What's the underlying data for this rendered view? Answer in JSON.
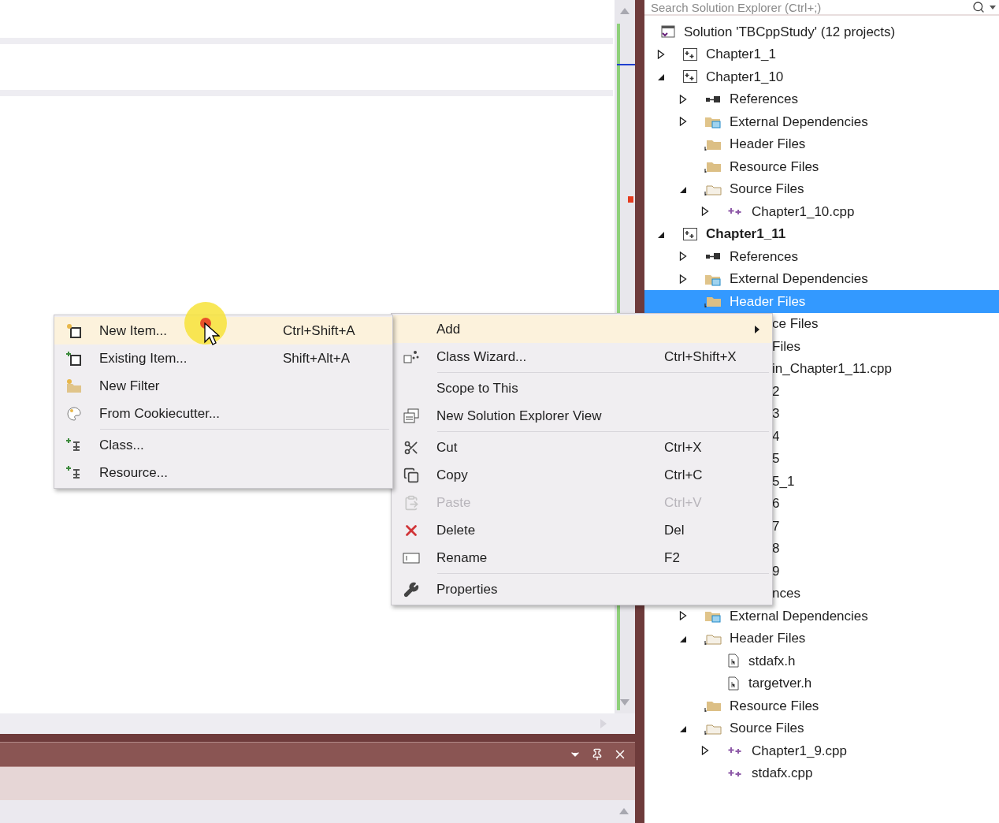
{
  "solution_explorer": {
    "search": {
      "placeholder": "Search Solution Explorer (Ctrl+;)"
    },
    "tree": [
      {
        "kind": "solution",
        "label": "Solution 'TBCppStudy' (12 projects)",
        "selected": false,
        "children": [
          {
            "kind": "project",
            "label": "Chapter1_1",
            "selected": false,
            "expanded": false,
            "startup": false
          },
          {
            "kind": "project",
            "label": "Chapter1_10",
            "selected": false,
            "expanded": true,
            "startup": false,
            "children": [
              {
                "kind": "references",
                "label": "References",
                "selected": false,
                "expanded": false
              },
              {
                "kind": "external",
                "label": "External Dependencies",
                "selected": false,
                "expanded": false
              },
              {
                "kind": "folder",
                "label": "Header Files",
                "selected": false
              },
              {
                "kind": "folder",
                "label": "Resource Files",
                "selected": false
              },
              {
                "kind": "folder-open",
                "label": "Source Files",
                "selected": false,
                "expanded": true,
                "children": [
                  {
                    "kind": "cpp",
                    "label": "Chapter1_10.cpp",
                    "selected": false,
                    "expanded": false
                  }
                ]
              }
            ]
          },
          {
            "kind": "project",
            "label": "Chapter1_11",
            "selected": false,
            "expanded": true,
            "startup": true,
            "children": [
              {
                "kind": "references",
                "label": "References",
                "selected": false,
                "expanded": false
              },
              {
                "kind": "external",
                "label": "External Dependencies",
                "selected": false,
                "expanded": false
              },
              {
                "kind": "folder",
                "label": "Header Files",
                "selected": true
              },
              {
                "kind": "cut",
                "label": "ce Files",
                "selected": false
              },
              {
                "kind": "cut",
                "label": "Files",
                "selected": false,
                "children": [
                  {
                    "kind": "cut",
                    "label": "in_Chapter1_11.cpp",
                    "selected": false
                  }
                ]
              }
            ]
          },
          {
            "kind": "cut",
            "label": "2",
            "selected": false
          },
          {
            "kind": "cut",
            "label": "3",
            "selected": false
          },
          {
            "kind": "cut",
            "label": "4",
            "selected": false
          },
          {
            "kind": "cut",
            "label": "5",
            "selected": false
          },
          {
            "kind": "cut",
            "label": "5_1",
            "selected": false
          },
          {
            "kind": "cut",
            "label": "6",
            "selected": false
          },
          {
            "kind": "cut",
            "label": "7",
            "selected": false
          },
          {
            "kind": "cut",
            "label": "8",
            "selected": false
          },
          {
            "kind": "cut",
            "label": "9",
            "selected": false,
            "children": [
              {
                "kind": "cut",
                "label": "nces",
                "selected": false
              },
              {
                "kind": "external",
                "label": "External Dependencies",
                "selected": false,
                "expanded": false
              },
              {
                "kind": "folder-open",
                "label": "Header Files",
                "selected": false,
                "expanded": true,
                "children": [
                  {
                    "kind": "header",
                    "label": "stdafx.h",
                    "selected": false
                  },
                  {
                    "kind": "header",
                    "label": "targetver.h",
                    "selected": false
                  }
                ]
              },
              {
                "kind": "folder",
                "label": "Resource Files",
                "selected": false
              },
              {
                "kind": "folder-open",
                "label": "Source Files",
                "selected": false,
                "expanded": true,
                "children": [
                  {
                    "kind": "cpp",
                    "label": "Chapter1_9.cpp",
                    "selected": false,
                    "expanded": false
                  },
                  {
                    "kind": "cpp",
                    "label": "stdafx.cpp",
                    "selected": false
                  }
                ]
              }
            ]
          }
        ]
      }
    ]
  },
  "context_menu": {
    "items": [
      {
        "kind": "plain",
        "label": "Add",
        "submenu": true,
        "selected": true,
        "disabled": false
      },
      {
        "kind": "class-wizard",
        "label": "Class Wizard...",
        "shortcut": "Ctrl+Shift+X",
        "submenu": false,
        "selected": false,
        "disabled": false
      },
      {
        "kind": "separator"
      },
      {
        "kind": "plain",
        "label": "Scope to This",
        "submenu": false,
        "selected": false,
        "disabled": false
      },
      {
        "kind": "new-view",
        "label": "New Solution Explorer View",
        "submenu": false,
        "selected": false,
        "disabled": false
      },
      {
        "kind": "separator"
      },
      {
        "kind": "cut",
        "label": "Cut",
        "shortcut": "Ctrl+X",
        "submenu": false,
        "selected": false,
        "disabled": false
      },
      {
        "kind": "copy",
        "label": "Copy",
        "shortcut": "Ctrl+C",
        "submenu": false,
        "selected": false,
        "disabled": false
      },
      {
        "kind": "paste",
        "label": "Paste",
        "shortcut": "Ctrl+V",
        "submenu": false,
        "selected": false,
        "disabled": true
      },
      {
        "kind": "delete",
        "label": "Delete",
        "shortcut": "Del",
        "submenu": false,
        "selected": false,
        "disabled": false
      },
      {
        "kind": "rename",
        "label": "Rename",
        "shortcut": "F2",
        "submenu": false,
        "selected": false,
        "disabled": false
      },
      {
        "kind": "separator"
      },
      {
        "kind": "properties",
        "label": "Properties",
        "submenu": false,
        "selected": false,
        "disabled": false
      }
    ]
  },
  "add_submenu": {
    "items": [
      {
        "kind": "new-item",
        "label": "New Item...",
        "shortcut": "Ctrl+Shift+A",
        "selected": true,
        "disabled": false
      },
      {
        "kind": "existing-item",
        "label": "Existing Item...",
        "shortcut": "Shift+Alt+A",
        "selected": false,
        "disabled": false
      },
      {
        "kind": "new-filter",
        "label": "New Filter",
        "selected": false,
        "disabled": false
      },
      {
        "kind": "cookiecutter",
        "label": "From Cookiecutter...",
        "selected": false,
        "disabled": false
      },
      {
        "kind": "separator"
      },
      {
        "kind": "class",
        "label": "Class...",
        "selected": false,
        "disabled": false
      },
      {
        "kind": "class",
        "label": "Resource...",
        "selected": false,
        "disabled": false
      }
    ]
  }
}
